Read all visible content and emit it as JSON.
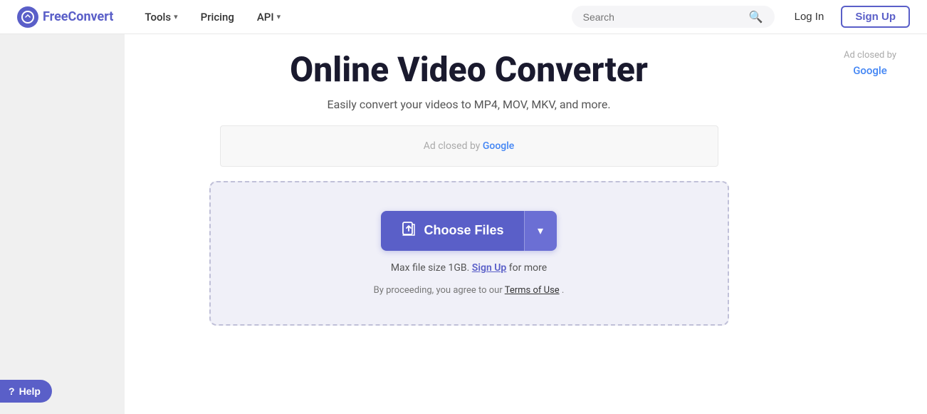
{
  "header": {
    "logo_text_free": "Free",
    "logo_text_convert": "Convert",
    "logo_icon": "fc",
    "nav": [
      {
        "label": "Tools",
        "has_dropdown": true
      },
      {
        "label": "Pricing",
        "has_dropdown": false
      },
      {
        "label": "API",
        "has_dropdown": true
      }
    ],
    "search_placeholder": "Search",
    "login_label": "Log In",
    "signup_label": "Sign Up"
  },
  "main": {
    "page_title": "Online Video Converter",
    "page_subtitle": "Easily convert your videos to MP4, MOV, MKV, and more.",
    "ad_banner": {
      "text_prefix": "Ad closed by ",
      "google_text": "Google"
    },
    "upload_area": {
      "choose_files_label": "Choose Files",
      "file_size_text": "Max file size 1GB.",
      "signup_link_text": "Sign Up",
      "file_size_suffix": " for more",
      "terms_text": "By proceeding, you agree to our ",
      "terms_link_text": "Terms of Use",
      "terms_period": "."
    },
    "right_ad": {
      "text": "Ad closed by ",
      "google": "Google"
    },
    "help_label": "Help"
  }
}
